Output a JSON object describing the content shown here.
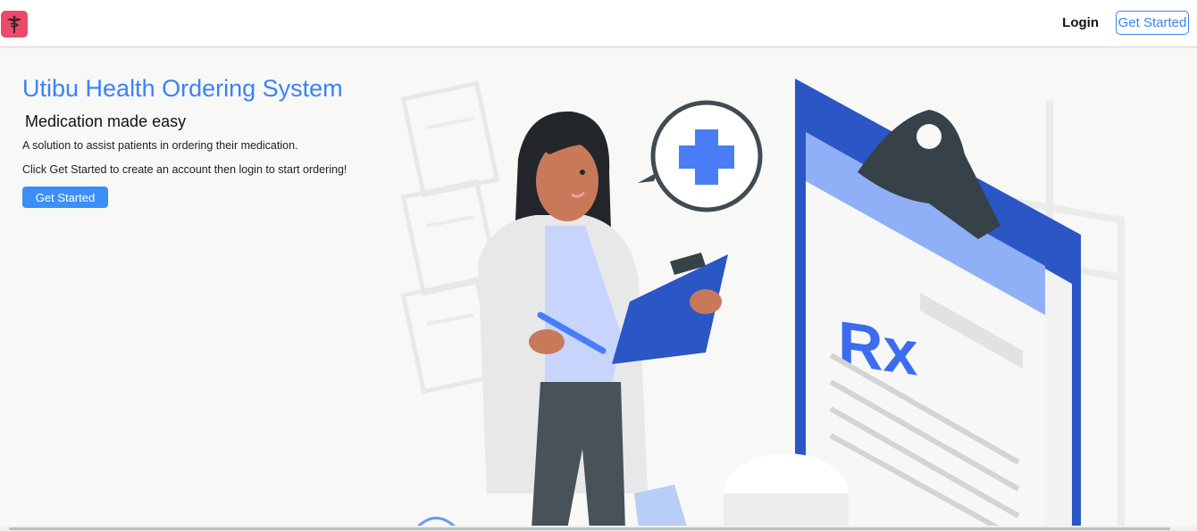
{
  "navbar": {
    "logo_icon": "caduceus-icon",
    "login_label": "Login",
    "cta_label": "Get Started"
  },
  "hero": {
    "title": "Utibu Health Ordering System",
    "subtitle": "Medication made easy",
    "description": "A solution to assist patients in ordering their medication.",
    "instruction": "Click Get Started to create an account then login to start ordering!",
    "cta_label": "Get Started",
    "illustration": {
      "rx_label": "Rx",
      "icons": [
        "doctor-figure",
        "medical-cross-icon",
        "clipboard-icon",
        "prescription-clipboard"
      ]
    }
  },
  "colors": {
    "accent": "#3b82f6",
    "logo_bg": "#ec4a6b",
    "page_bg": "#f8f8f7"
  }
}
